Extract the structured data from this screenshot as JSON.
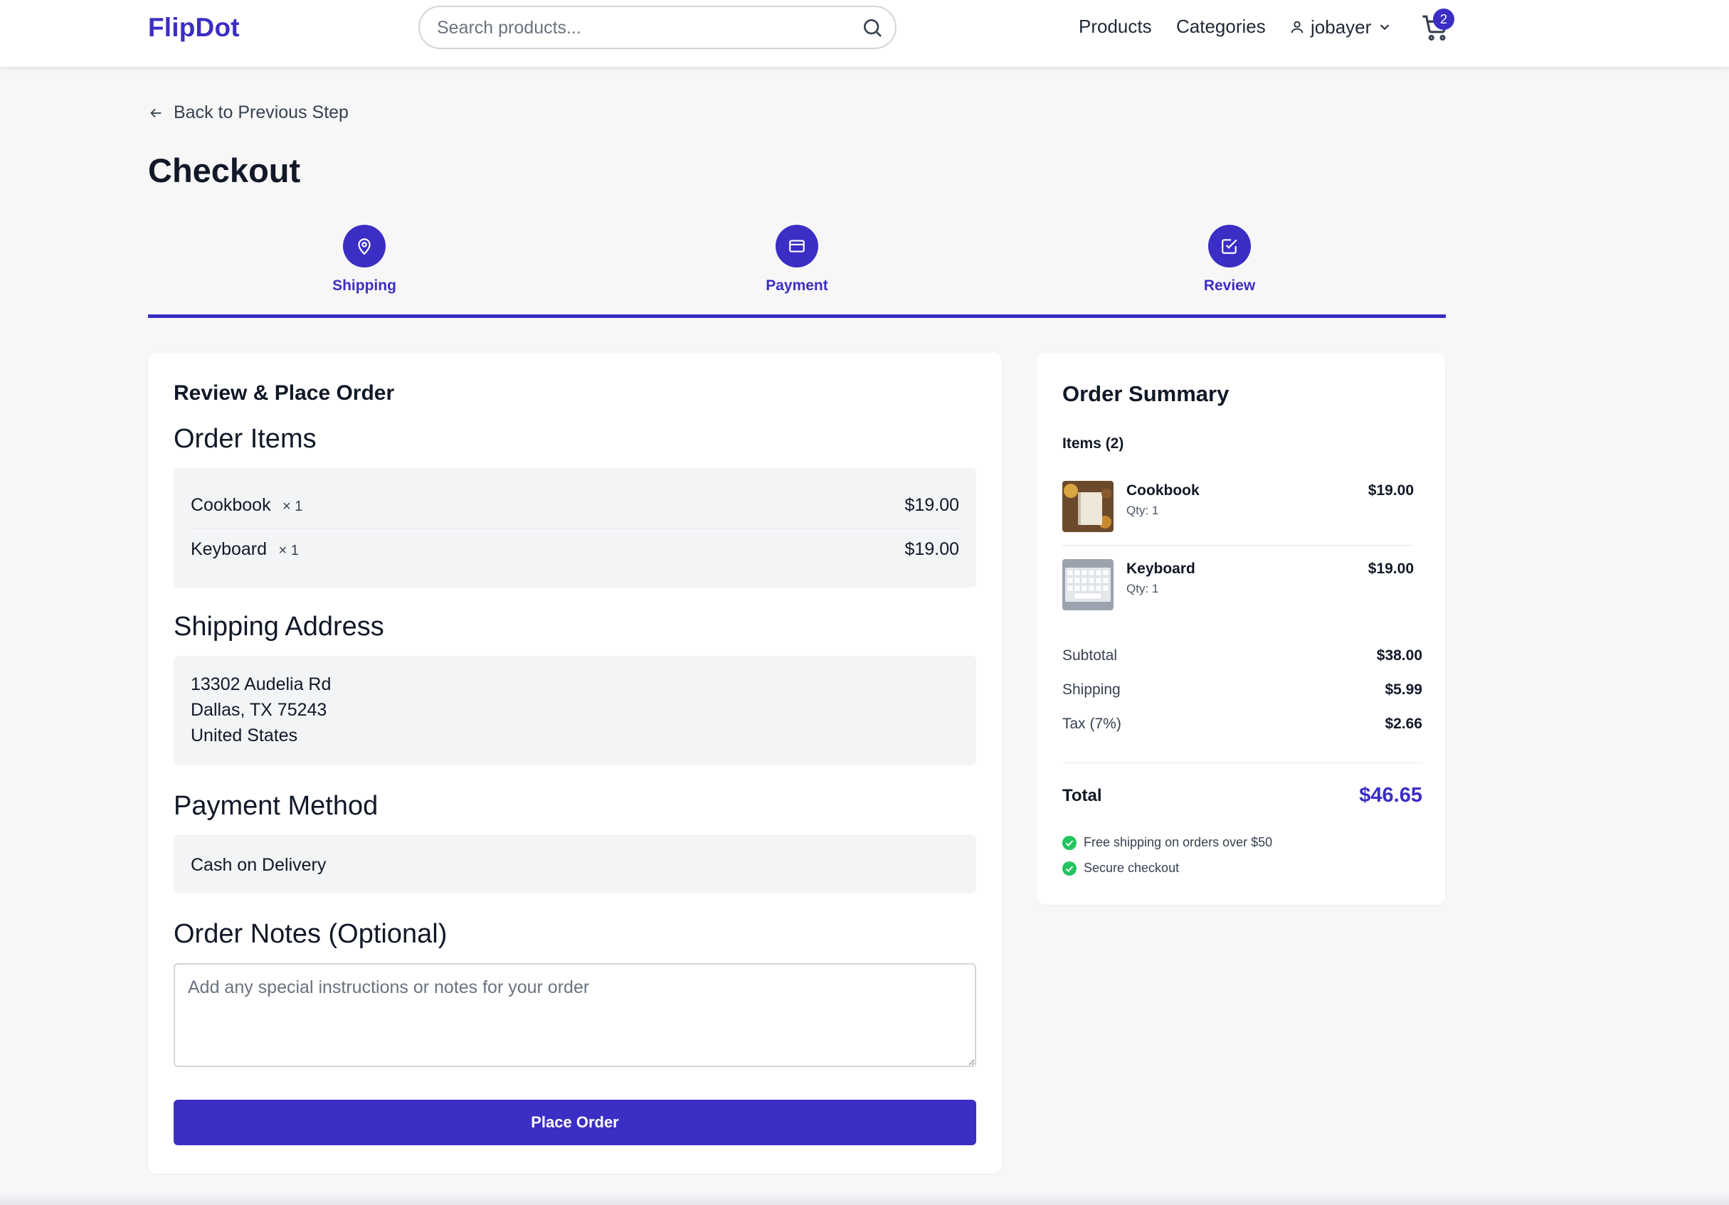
{
  "header": {
    "logo": "FlipDot",
    "search_placeholder": "Search products...",
    "nav": {
      "products": "Products",
      "categories": "Categories"
    },
    "user": "jobayer",
    "cart_count": "2"
  },
  "back_label": "Back to Previous Step",
  "page_title": "Checkout",
  "steps": [
    {
      "label": "Shipping",
      "icon": "map-pin-icon"
    },
    {
      "label": "Payment",
      "icon": "credit-card-icon"
    },
    {
      "label": "Review",
      "icon": "check-square-icon"
    }
  ],
  "review": {
    "heading": "Review & Place Order",
    "order_items_title": "Order Items",
    "items": [
      {
        "name": "Cookbook",
        "qty": "× 1",
        "price": "$19.00"
      },
      {
        "name": "Keyboard",
        "qty": "× 1",
        "price": "$19.00"
      }
    ],
    "shipping_title": "Shipping Address",
    "address": [
      "13302 Audelia Rd",
      "Dallas, TX 75243",
      "United States"
    ],
    "payment_title": "Payment Method",
    "payment_method": "Cash on Delivery",
    "notes_title": "Order Notes (Optional)",
    "notes_placeholder": "Add any special instructions or notes for your order",
    "place_order": "Place Order"
  },
  "summary": {
    "title": "Order Summary",
    "items_count": "Items (2)",
    "items": [
      {
        "name": "Cookbook",
        "qty": "Qty: 1",
        "price": "$19.00"
      },
      {
        "name": "Keyboard",
        "qty": "Qty: 1",
        "price": "$19.00"
      }
    ],
    "subtotal_label": "Subtotal",
    "subtotal": "$38.00",
    "shipping_label": "Shipping",
    "shipping": "$5.99",
    "tax_label": "Tax (7%)",
    "tax": "$2.66",
    "total_label": "Total",
    "total": "$46.65",
    "perks": [
      "Free shipping on orders over $50",
      "Secure checkout"
    ]
  },
  "colors": {
    "accent": "#3b2ec4",
    "success": "#22c55e",
    "background": "#f7f7f8"
  }
}
